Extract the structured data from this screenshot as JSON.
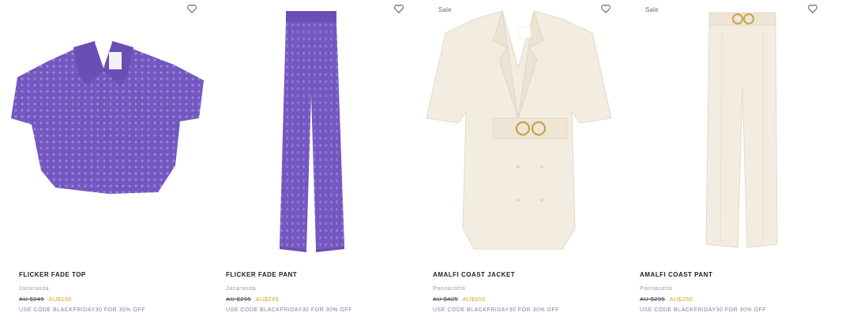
{
  "products": [
    {
      "name": "FLICKER FADE TOP",
      "color": "Jacaranda",
      "old_price": "AU $245",
      "new_price": "AU$195",
      "promo": "USE CODE BLACKFRIDAY30 FOR 30% OFF",
      "badge": "",
      "image": "purple-crochet-top"
    },
    {
      "name": "FLICKER FADE PANT",
      "color": "Jacaranda",
      "old_price": "AU $295",
      "new_price": "AU$245",
      "promo": "USE CODE BLACKFRIDAY30 FOR 30% OFF",
      "badge": "",
      "image": "purple-crochet-pant"
    },
    {
      "name": "AMALFI COAST JACKET",
      "color": "Pannacotta",
      "old_price": "AU $425",
      "new_price": "AU$350",
      "promo": "USE CODE BLACKFRIDAY30 FOR 30% OFF",
      "badge": "Sale",
      "image": "cream-belted-jacket"
    },
    {
      "name": "AMALFI COAST PANT",
      "color": "Pannacotta",
      "old_price": "AU $295",
      "new_price": "AU$250",
      "promo": "USE CODE BLACKFRIDAY30 FOR 30% OFF",
      "badge": "Sale",
      "image": "cream-belted-pant"
    }
  ],
  "colors": {
    "sale_price": "#e3a01b",
    "promo": "#7a7fb0",
    "purple_garment": "#7457c0",
    "cream_garment": "#f3ece0"
  },
  "icons": {
    "wishlist": "heart-outline-icon"
  }
}
